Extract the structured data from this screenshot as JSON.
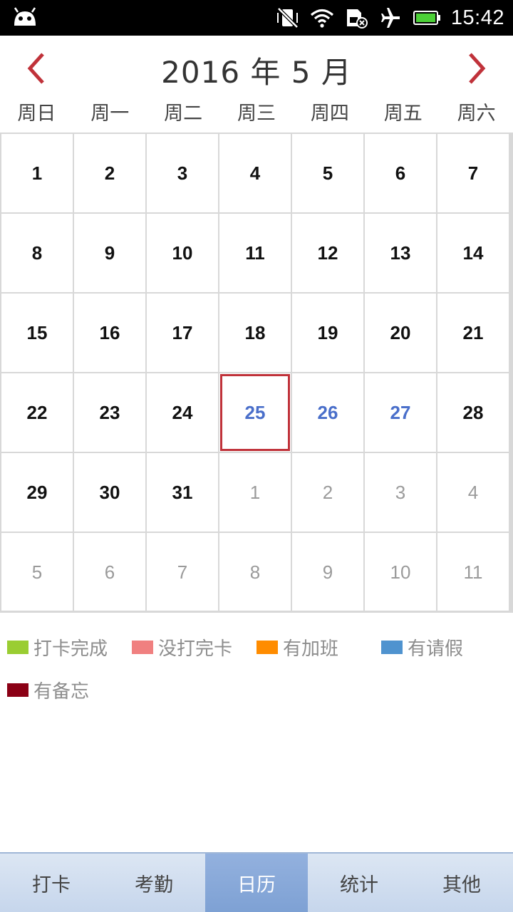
{
  "status_bar": {
    "time": "15:42",
    "icons": [
      "android-icon",
      "vibrate-off-icon",
      "wifi-icon",
      "sim-error-icon",
      "airplane-mode-icon",
      "battery-icon"
    ],
    "battery_color": "#4cd137"
  },
  "header": {
    "title": "2016 年 5 月",
    "prev_icon": "chevron-left-icon",
    "next_icon": "chevron-right-icon",
    "arrow_color": "#c0323a"
  },
  "weekdays": [
    "周日",
    "周一",
    "周二",
    "周三",
    "周四",
    "周五",
    "周六"
  ],
  "calendar": {
    "today": "25",
    "rows": [
      [
        {
          "d": "1",
          "s": "cur"
        },
        {
          "d": "2",
          "s": "cur"
        },
        {
          "d": "3",
          "s": "cur"
        },
        {
          "d": "4",
          "s": "cur"
        },
        {
          "d": "5",
          "s": "cur"
        },
        {
          "d": "6",
          "s": "cur"
        },
        {
          "d": "7",
          "s": "cur"
        }
      ],
      [
        {
          "d": "8",
          "s": "cur"
        },
        {
          "d": "9",
          "s": "cur"
        },
        {
          "d": "10",
          "s": "cur"
        },
        {
          "d": "11",
          "s": "cur"
        },
        {
          "d": "12",
          "s": "cur"
        },
        {
          "d": "13",
          "s": "cur"
        },
        {
          "d": "14",
          "s": "cur"
        }
      ],
      [
        {
          "d": "15",
          "s": "cur"
        },
        {
          "d": "16",
          "s": "cur"
        },
        {
          "d": "17",
          "s": "cur"
        },
        {
          "d": "18",
          "s": "cur"
        },
        {
          "d": "19",
          "s": "cur"
        },
        {
          "d": "20",
          "s": "cur"
        },
        {
          "d": "21",
          "s": "cur"
        }
      ],
      [
        {
          "d": "22",
          "s": "cur"
        },
        {
          "d": "23",
          "s": "cur"
        },
        {
          "d": "24",
          "s": "cur"
        },
        {
          "d": "25",
          "s": "today"
        },
        {
          "d": "26",
          "s": "future"
        },
        {
          "d": "27",
          "s": "future"
        },
        {
          "d": "28",
          "s": "cur"
        }
      ],
      [
        {
          "d": "29",
          "s": "cur"
        },
        {
          "d": "30",
          "s": "cur"
        },
        {
          "d": "31",
          "s": "cur"
        },
        {
          "d": "1",
          "s": "other"
        },
        {
          "d": "2",
          "s": "other"
        },
        {
          "d": "3",
          "s": "other"
        },
        {
          "d": "4",
          "s": "other"
        }
      ],
      [
        {
          "d": "5",
          "s": "other"
        },
        {
          "d": "6",
          "s": "other"
        },
        {
          "d": "7",
          "s": "other"
        },
        {
          "d": "8",
          "s": "other"
        },
        {
          "d": "9",
          "s": "other"
        },
        {
          "d": "10",
          "s": "other"
        },
        {
          "d": "11",
          "s": "other"
        }
      ]
    ],
    "colors": {
      "today_border": "#c0323a",
      "future_text": "#4a6fca",
      "other_text": "#9b9b9b"
    }
  },
  "legend": [
    {
      "label": "打卡完成",
      "color": "#9acd32"
    },
    {
      "label": "没打完卡",
      "color": "#f08080"
    },
    {
      "label": "有加班",
      "color": "#ff8c00"
    },
    {
      "label": "有请假",
      "color": "#4f93cf"
    },
    {
      "label": "有备忘",
      "color": "#8b0015"
    }
  ],
  "tabs": [
    {
      "label": "打卡",
      "active": false
    },
    {
      "label": "考勤",
      "active": false
    },
    {
      "label": "日历",
      "active": true
    },
    {
      "label": "统计",
      "active": false
    },
    {
      "label": "其他",
      "active": false
    }
  ]
}
